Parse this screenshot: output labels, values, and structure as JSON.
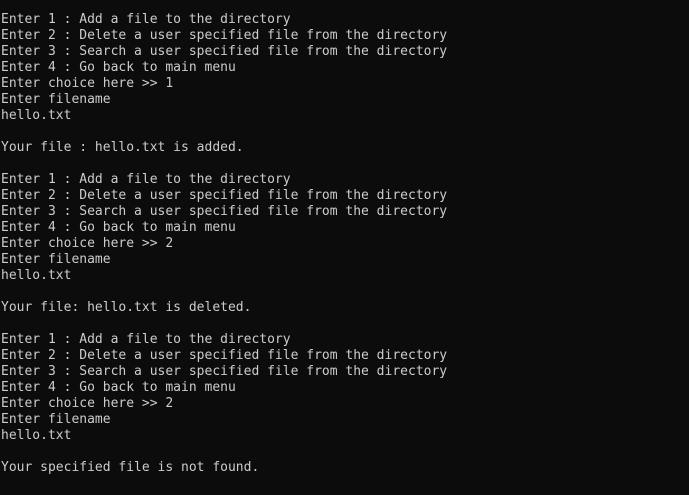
{
  "console": {
    "lines": [
      "Enter 1 : Add a file to the directory",
      "Enter 2 : Delete a user specified file from the directory",
      "Enter 3 : Search a user specified file from the directory",
      "Enter 4 : Go back to main menu",
      "Enter choice here >> 1",
      "Enter filename",
      "hello.txt",
      "",
      "Your file : hello.txt is added.",
      "",
      "Enter 1 : Add a file to the directory",
      "Enter 2 : Delete a user specified file from the directory",
      "Enter 3 : Search a user specified file from the directory",
      "Enter 4 : Go back to main menu",
      "Enter choice here >> 2",
      "Enter filename",
      "hello.txt",
      "",
      "Your file: hello.txt is deleted.",
      "",
      "Enter 1 : Add a file to the directory",
      "Enter 2 : Delete a user specified file from the directory",
      "Enter 3 : Search a user specified file from the directory",
      "Enter 4 : Go back to main menu",
      "Enter choice here >> 2",
      "Enter filename",
      "hello.txt",
      "",
      "Your specified file is not found."
    ]
  },
  "colors": {
    "background": "#0c0c0c",
    "text": "#cccccc"
  }
}
